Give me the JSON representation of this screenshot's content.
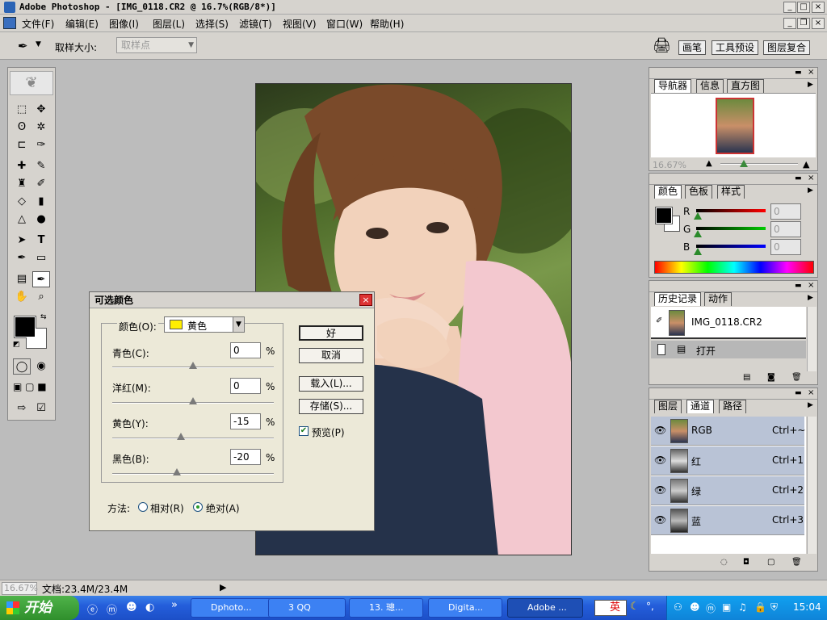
{
  "window": {
    "title": "Adobe Photoshop - [IMG_0118.CR2 @ 16.7%(RGB/8*)]"
  },
  "menu": [
    "文件(F)",
    "编辑(E)",
    "图像(I)",
    "图层(L)",
    "选择(S)",
    "滤镜(T)",
    "视图(V)",
    "窗口(W)",
    "帮助(H)"
  ],
  "options": {
    "sample_label": "取样大小:",
    "sample_value": "取样点"
  },
  "well_tabs": [
    "画笔",
    "工具预设",
    "图层复合"
  ],
  "navigator": {
    "tabs": [
      "导航器",
      "信息",
      "直方图"
    ],
    "zoom": "16.67%"
  },
  "color": {
    "tabs": [
      "颜色",
      "色板",
      "样式"
    ],
    "r_label": "R",
    "g_label": "G",
    "b_label": "B",
    "r": "0",
    "g": "0",
    "b": "0"
  },
  "history": {
    "tabs": [
      "历史记录",
      "动作"
    ],
    "snapshot": "IMG_0118.CR2",
    "state": "打开"
  },
  "channels": {
    "tabs": [
      "图层",
      "通道",
      "路径"
    ],
    "rows": [
      {
        "name": "RGB",
        "shortcut": "Ctrl+~"
      },
      {
        "name": "红",
        "shortcut": "Ctrl+1"
      },
      {
        "name": "绿",
        "shortcut": "Ctrl+2"
      },
      {
        "name": "蓝",
        "shortcut": "Ctrl+3"
      }
    ]
  },
  "dialog": {
    "title": "可选颜色",
    "color_label": "颜色(O):",
    "color_value": "黄色",
    "color_swatch": "#ffee00",
    "sliders": [
      {
        "label": "青色(C):",
        "value": "0",
        "unit": "%",
        "fraction": 0.5
      },
      {
        "label": "洋红(M):",
        "value": "0",
        "unit": "%",
        "fraction": 0.5
      },
      {
        "label": "黄色(Y):",
        "value": "-15",
        "unit": "%",
        "fraction": 0.425
      },
      {
        "label": "黑色(B):",
        "value": "-20",
        "unit": "%",
        "fraction": 0.4
      }
    ],
    "ok": "好",
    "cancel": "取消",
    "load": "载入(L)...",
    "save": "存储(S)...",
    "preview": "预览(P)",
    "method_label": "方法:",
    "relative": "相对(R)",
    "absolute": "绝对(A)"
  },
  "status": {
    "zoom": "16.67%",
    "doc": "文档:23.4M/23.4M"
  },
  "taskbar": {
    "start": "开始",
    "tasks": [
      "Dphoto...",
      "3 QQ",
      "13. 璁...",
      "Digita...",
      "Adobe ..."
    ],
    "ime": "英",
    "clock": "15:04"
  }
}
